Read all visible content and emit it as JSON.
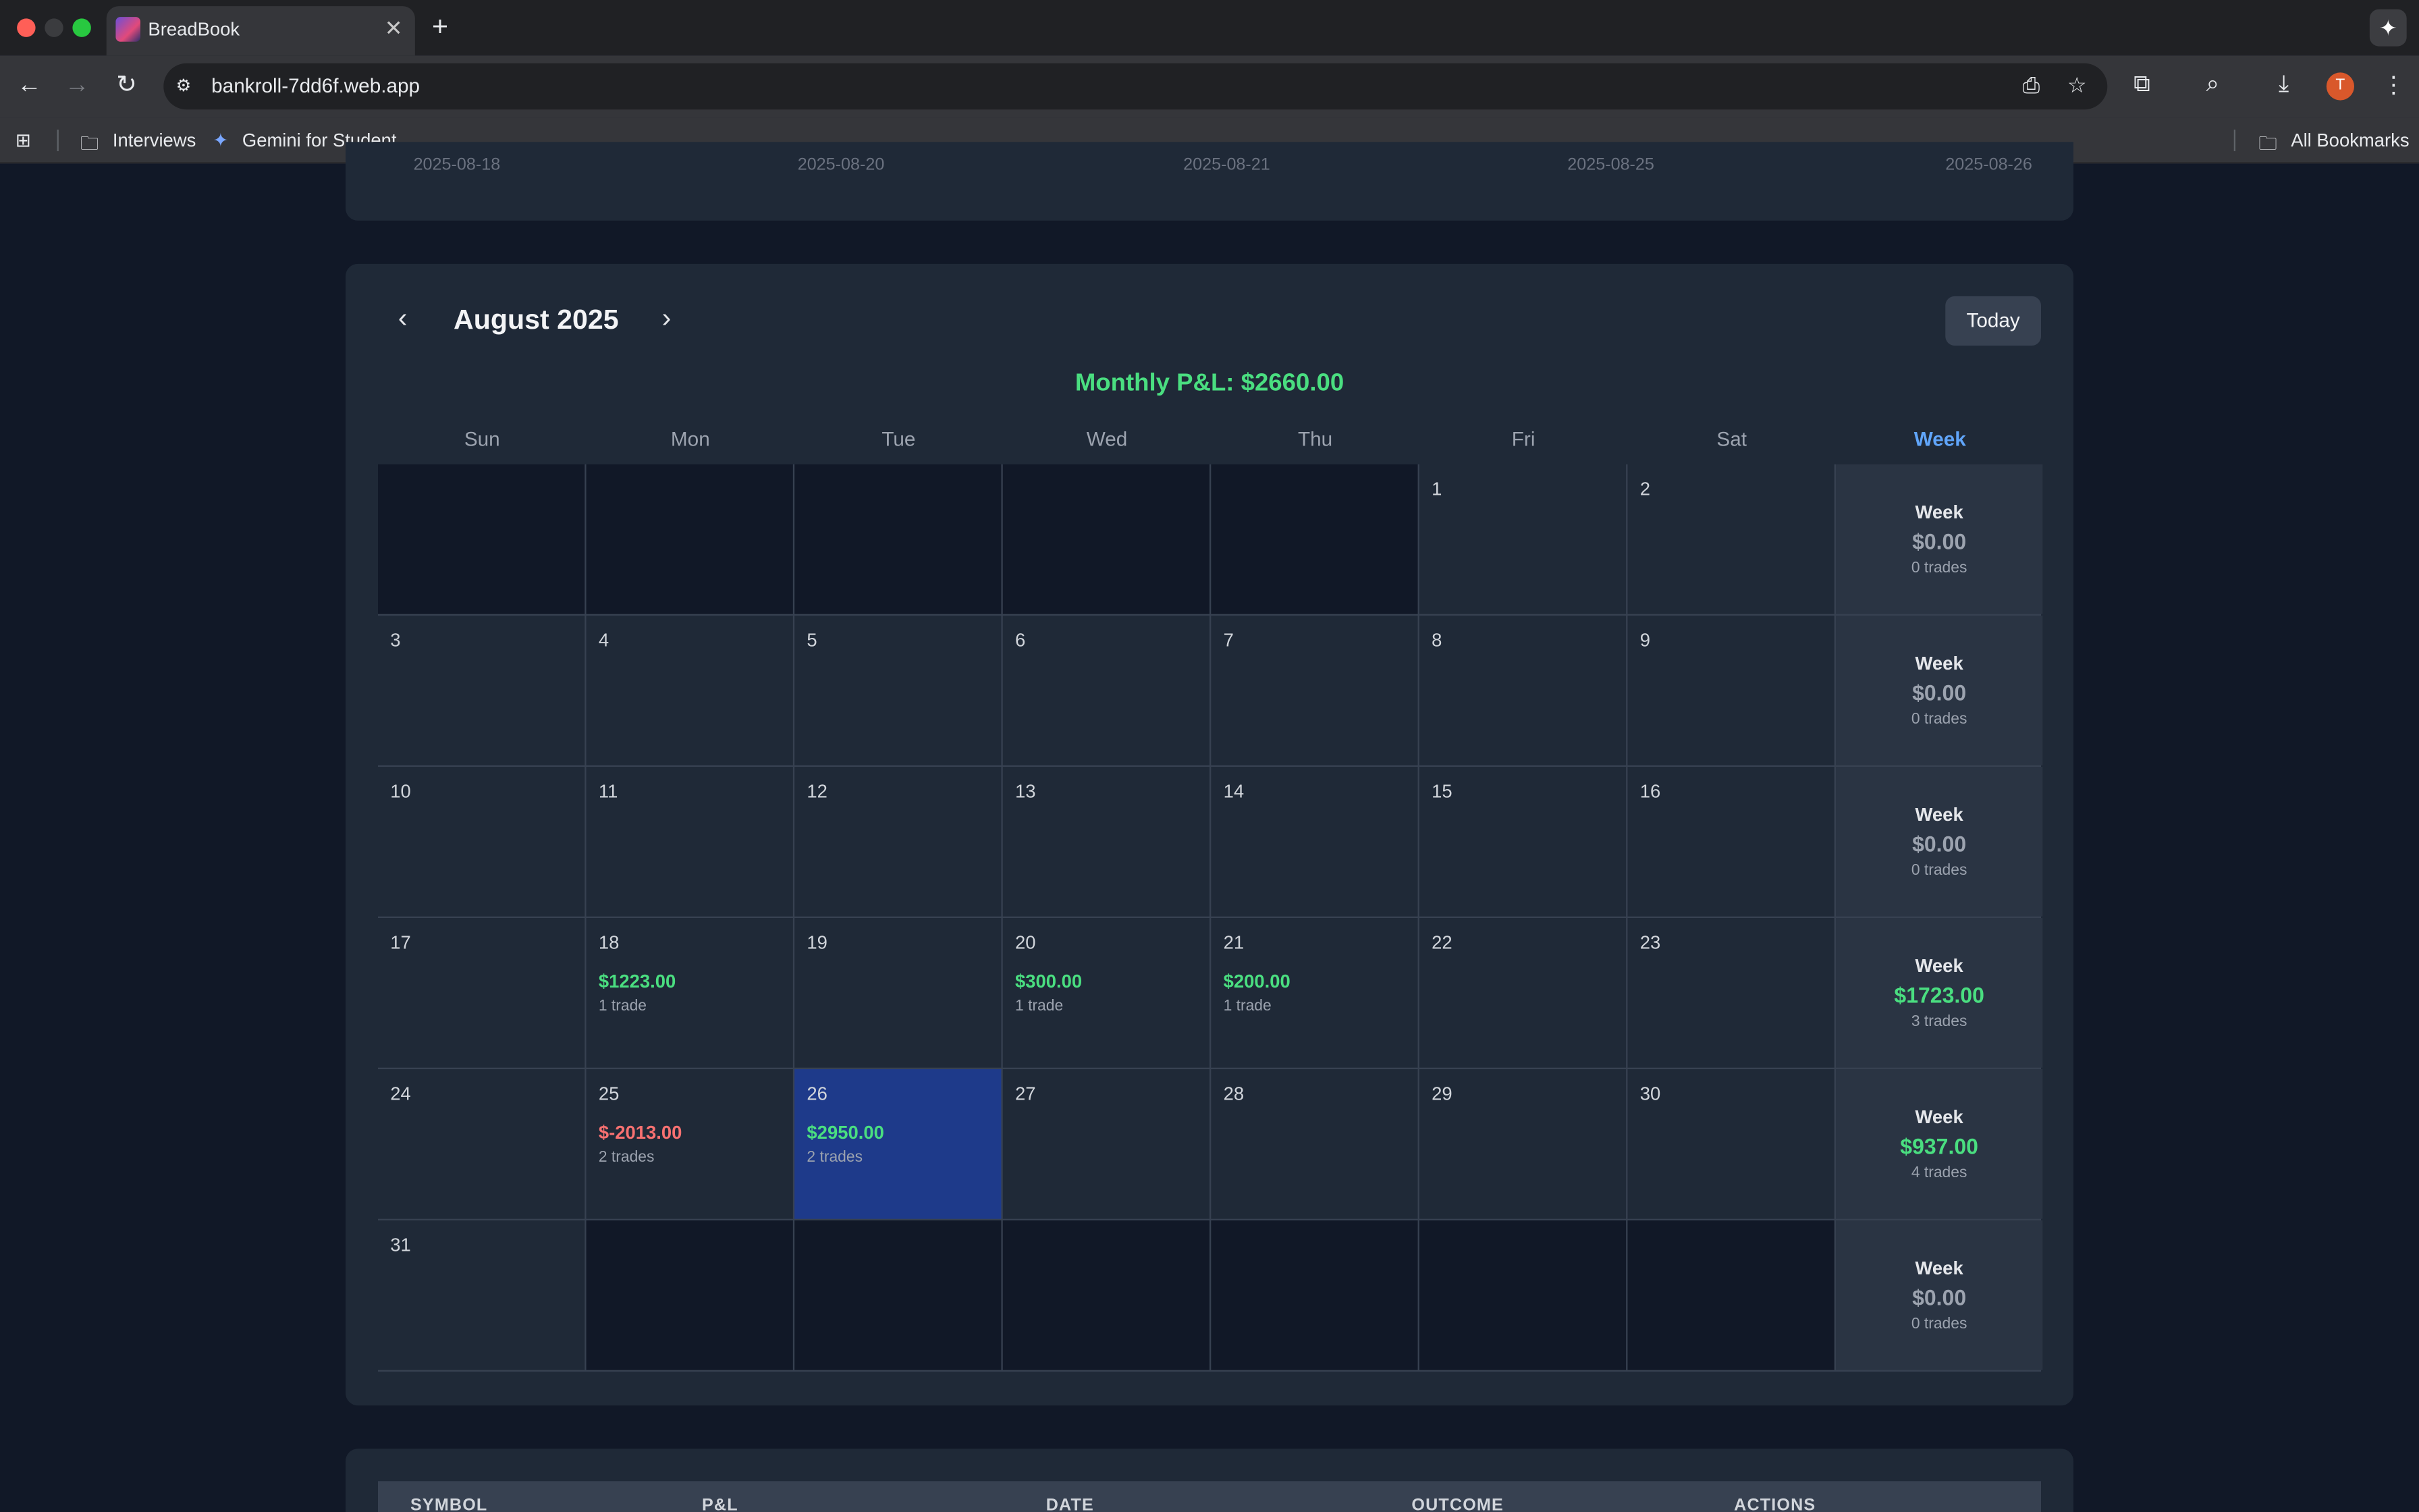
{
  "browser": {
    "tab_title": "BreadBook",
    "url": "bankroll-7dd6f.web.app",
    "avatar_letter": "T",
    "bookmarks": [
      "Interviews",
      "Gemini for Student..."
    ],
    "all_bookmarks": "All Bookmarks"
  },
  "chart_axis_dates": [
    "2025-08-18",
    "2025-08-20",
    "2025-08-21",
    "2025-08-25",
    "2025-08-26"
  ],
  "calendar": {
    "month_label": "August 2025",
    "today_label": "Today",
    "monthly_pnl": "Monthly P&L: $2660.00",
    "weekdays": [
      "Sun",
      "Mon",
      "Tue",
      "Wed",
      "Thu",
      "Fri",
      "Sat",
      "Week"
    ],
    "weeks": [
      {
        "days": [
          null,
          null,
          null,
          null,
          null,
          {
            "d": "1"
          },
          {
            "d": "2"
          }
        ],
        "summary": {
          "label": "Week",
          "value": "$0.00",
          "trades": "0 trades",
          "sign": "zero"
        }
      },
      {
        "days": [
          {
            "d": "3"
          },
          {
            "d": "4"
          },
          {
            "d": "5"
          },
          {
            "d": "6"
          },
          {
            "d": "7"
          },
          {
            "d": "8"
          },
          {
            "d": "9"
          }
        ],
        "summary": {
          "label": "Week",
          "value": "$0.00",
          "trades": "0 trades",
          "sign": "zero"
        }
      },
      {
        "days": [
          {
            "d": "10"
          },
          {
            "d": "11"
          },
          {
            "d": "12"
          },
          {
            "d": "13"
          },
          {
            "d": "14"
          },
          {
            "d": "15"
          },
          {
            "d": "16"
          }
        ],
        "summary": {
          "label": "Week",
          "value": "$0.00",
          "trades": "0 trades",
          "sign": "zero"
        }
      },
      {
        "days": [
          {
            "d": "17"
          },
          {
            "d": "18",
            "pnl": "$1223.00",
            "trades": "1 trade",
            "sign": "pos"
          },
          {
            "d": "19"
          },
          {
            "d": "20",
            "pnl": "$300.00",
            "trades": "1 trade",
            "sign": "pos"
          },
          {
            "d": "21",
            "pnl": "$200.00",
            "trades": "1 trade",
            "sign": "pos"
          },
          {
            "d": "22"
          },
          {
            "d": "23"
          }
        ],
        "summary": {
          "label": "Week",
          "value": "$1723.00",
          "trades": "3 trades",
          "sign": "pos"
        }
      },
      {
        "days": [
          {
            "d": "24"
          },
          {
            "d": "25",
            "pnl": "$-2013.00",
            "trades": "2 trades",
            "sign": "neg"
          },
          {
            "d": "26",
            "pnl": "$2950.00",
            "trades": "2 trades",
            "sign": "pos",
            "today": true
          },
          {
            "d": "27"
          },
          {
            "d": "28"
          },
          {
            "d": "29"
          },
          {
            "d": "30"
          }
        ],
        "summary": {
          "label": "Week",
          "value": "$937.00",
          "trades": "4 trades",
          "sign": "pos"
        }
      },
      {
        "days": [
          {
            "d": "31"
          },
          null,
          null,
          null,
          null,
          null,
          null
        ],
        "summary": {
          "label": "Week",
          "value": "$0.00",
          "trades": "0 trades",
          "sign": "zero"
        }
      }
    ]
  },
  "trades_table": {
    "headers": [
      "SYMBOL",
      "P&L",
      "DATE",
      "OUTCOME",
      "ACTIONS"
    ]
  }
}
